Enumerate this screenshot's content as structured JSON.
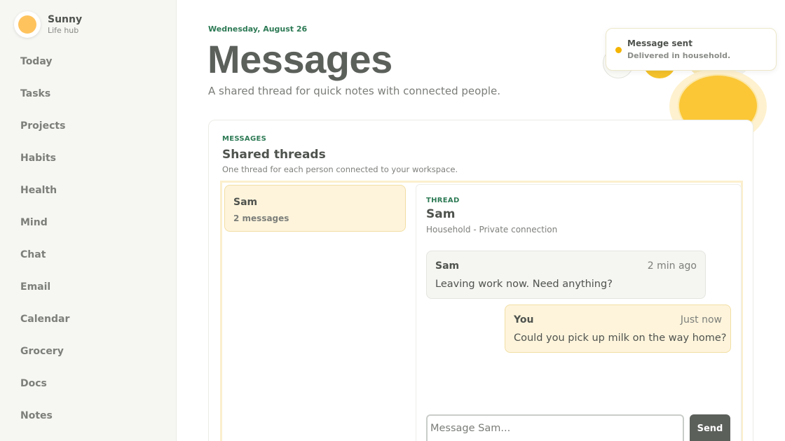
{
  "brand": {
    "name": "Sunny",
    "subtitle": "Life hub"
  },
  "sidebar": {
    "items": [
      {
        "label": "Today"
      },
      {
        "label": "Tasks"
      },
      {
        "label": "Projects"
      },
      {
        "label": "Habits"
      },
      {
        "label": "Health"
      },
      {
        "label": "Mind"
      },
      {
        "label": "Chat"
      },
      {
        "label": "Email"
      },
      {
        "label": "Calendar"
      },
      {
        "label": "Grocery"
      },
      {
        "label": "Docs"
      },
      {
        "label": "Notes"
      }
    ]
  },
  "header": {
    "date": "Wednesday, August 26",
    "title": "Messages",
    "subtitle": "A shared thread for quick notes with connected people."
  },
  "toast": {
    "title": "Message sent",
    "body": "Delivered in household."
  },
  "messages_card": {
    "eyebrow": "MESSAGES",
    "title": "Shared threads",
    "description": "One thread for each person connected to your workspace.",
    "threads": [
      {
        "name": "Sam",
        "count": "2 messages"
      }
    ]
  },
  "thread": {
    "eyebrow": "THREAD",
    "title": "Sam",
    "subtitle": "Household - Private connection",
    "messages": [
      {
        "author": "Sam",
        "time": "2 min ago",
        "text": "Leaving work now. Need anything?"
      },
      {
        "author": "You",
        "time": "Just now",
        "text": "Could you pick up milk on the way home?"
      }
    ],
    "composer_placeholder": "Message Sam...",
    "composer_value": "",
    "send_label": "Send"
  },
  "colors": {
    "accent_green": "#2d7a55",
    "accent_yellow": "#f4c22b",
    "highlight_bg": "#fef4dc",
    "button_dark": "#5c605b"
  },
  "icons": {
    "brand_logo": "sun-icon",
    "toast_indicator": "status-dot-icon"
  }
}
